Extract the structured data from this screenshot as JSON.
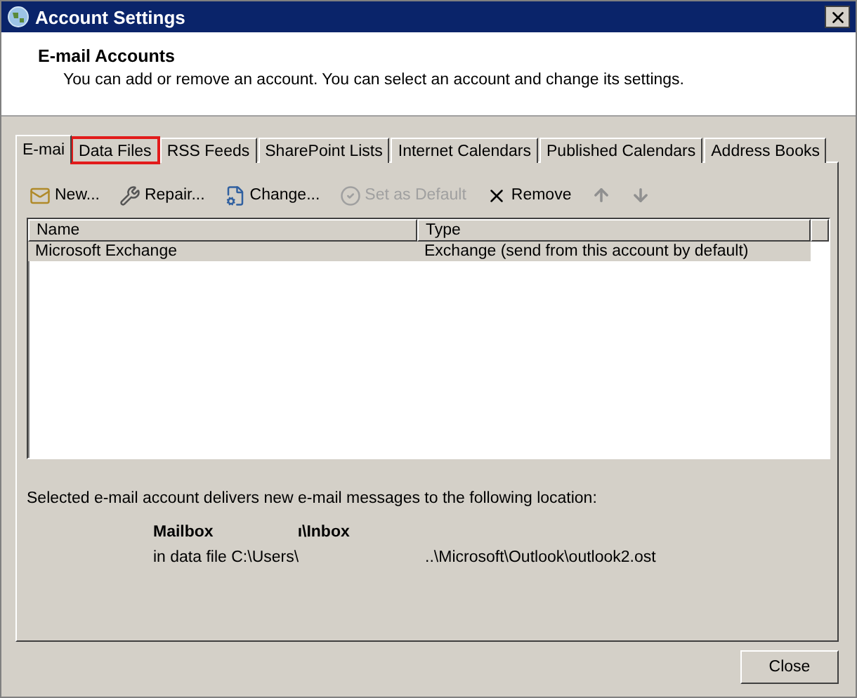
{
  "window": {
    "title": "Account Settings"
  },
  "header": {
    "title": "E-mail Accounts",
    "description": "You can add or remove an account. You can select an account and change its settings."
  },
  "tabs": [
    {
      "label": "E-mai",
      "selected": true,
      "highlighted": false
    },
    {
      "label": "Data Files",
      "selected": false,
      "highlighted": true
    },
    {
      "label": "RSS Feeds",
      "selected": false,
      "highlighted": false
    },
    {
      "label": "SharePoint Lists",
      "selected": false,
      "highlighted": false
    },
    {
      "label": "Internet Calendars",
      "selected": false,
      "highlighted": false
    },
    {
      "label": "Published Calendars",
      "selected": false,
      "highlighted": false
    },
    {
      "label": "Address Books",
      "selected": false,
      "highlighted": false
    }
  ],
  "toolbar": [
    {
      "kind": "new",
      "label": "New...",
      "disabled": false
    },
    {
      "kind": "repair",
      "label": "Repair...",
      "disabled": false
    },
    {
      "kind": "change",
      "label": "Change...",
      "disabled": false
    },
    {
      "kind": "default",
      "label": "Set as Default",
      "disabled": true
    },
    {
      "kind": "remove",
      "label": "Remove",
      "disabled": false
    },
    {
      "kind": "up",
      "disabled": true
    },
    {
      "kind": "down",
      "disabled": true
    }
  ],
  "table": {
    "columns": [
      "Name",
      "Type"
    ],
    "rows": [
      {
        "cells": [
          "Microsoft Exchange",
          "Exchange (send from this account by default)"
        ],
        "selected": true
      }
    ]
  },
  "location": {
    "intro": "Selected e-mail account delivers new e-mail messages to the following location:",
    "mailbox": [
      "Mailbox",
      "ı\\Inbox"
    ],
    "data_file": [
      "in data file C:\\Users\\",
      "..\\Microsoft\\Outlook\\outlook2.ost"
    ]
  },
  "buttons": [
    "Close"
  ]
}
